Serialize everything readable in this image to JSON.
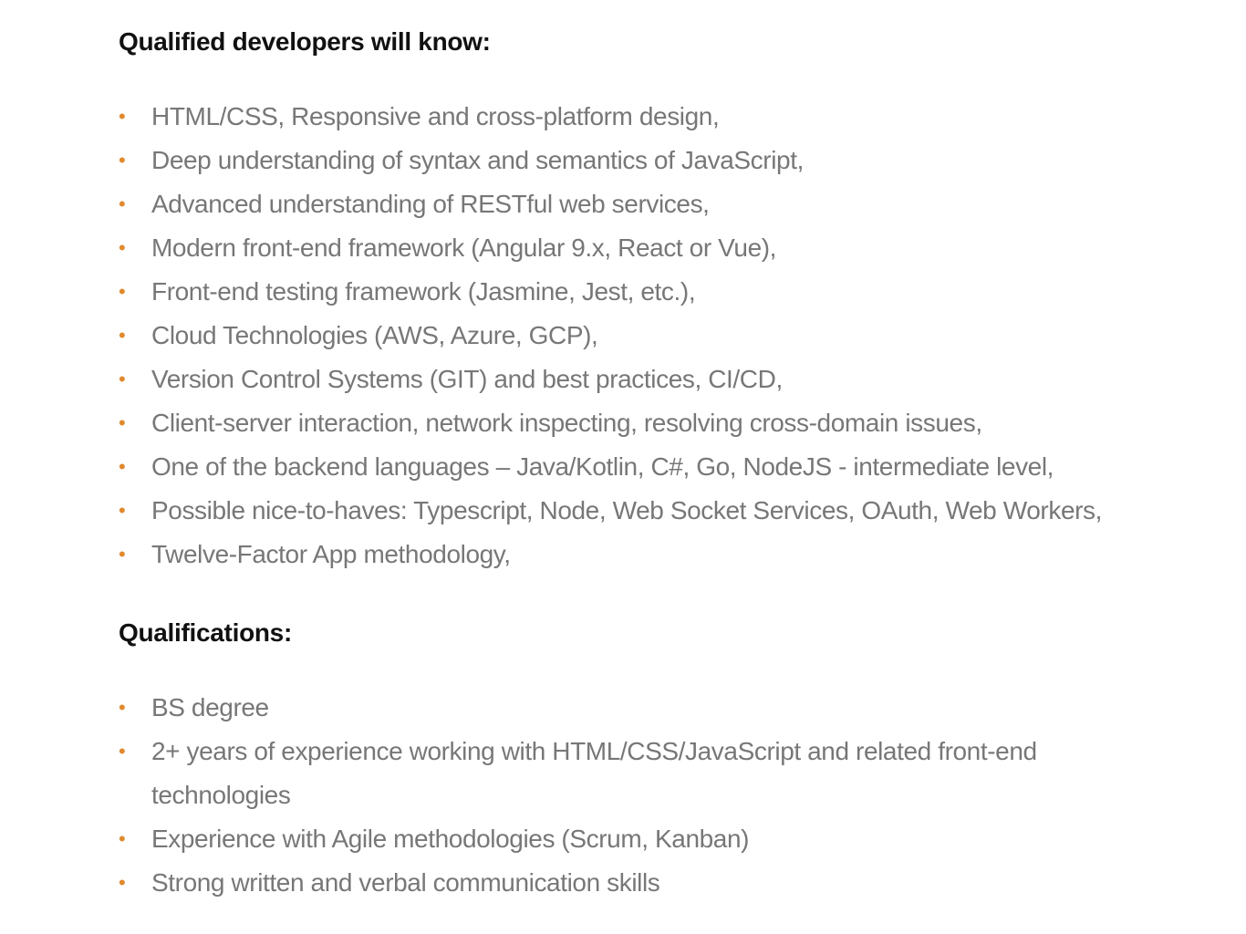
{
  "section_1": {
    "heading": "Qualified developers will know:",
    "items": [
      "HTML/CSS, Responsive and cross-platform design,",
      "Deep understanding of syntax and semantics of JavaScript,",
      "Advanced understanding of RESTful web services,",
      "Modern front-end framework (Angular 9.x, React or Vue),",
      "Front-end testing framework (Jasmine, Jest, etc.),",
      "Cloud Technologies (AWS, Azure, GCP),",
      "Version Control Systems (GIT) and best practices, CI/CD,",
      "Client-server interaction, network inspecting, resolving cross-domain issues,",
      "One of the backend languages – Java/Kotlin, C#, Go, NodeJS - intermediate level,",
      "Possible nice-to-haves: Typescript, Node, Web Socket Services, OAuth, Web Workers,",
      "Twelve-Factor App methodology,"
    ]
  },
  "section_2": {
    "heading": "Qualifications:",
    "items": [
      "BS degree",
      "2+ years of experience working with HTML/CSS/JavaScript and related front-end technologies",
      "Experience with Agile methodologies (Scrum, Kanban)",
      "Strong written and verbal communication skills"
    ]
  },
  "bullet_glyph": "•",
  "colors": {
    "heading": "#111111",
    "text": "#777777",
    "bullet": "#e08a2e",
    "background": "#ffffff"
  }
}
